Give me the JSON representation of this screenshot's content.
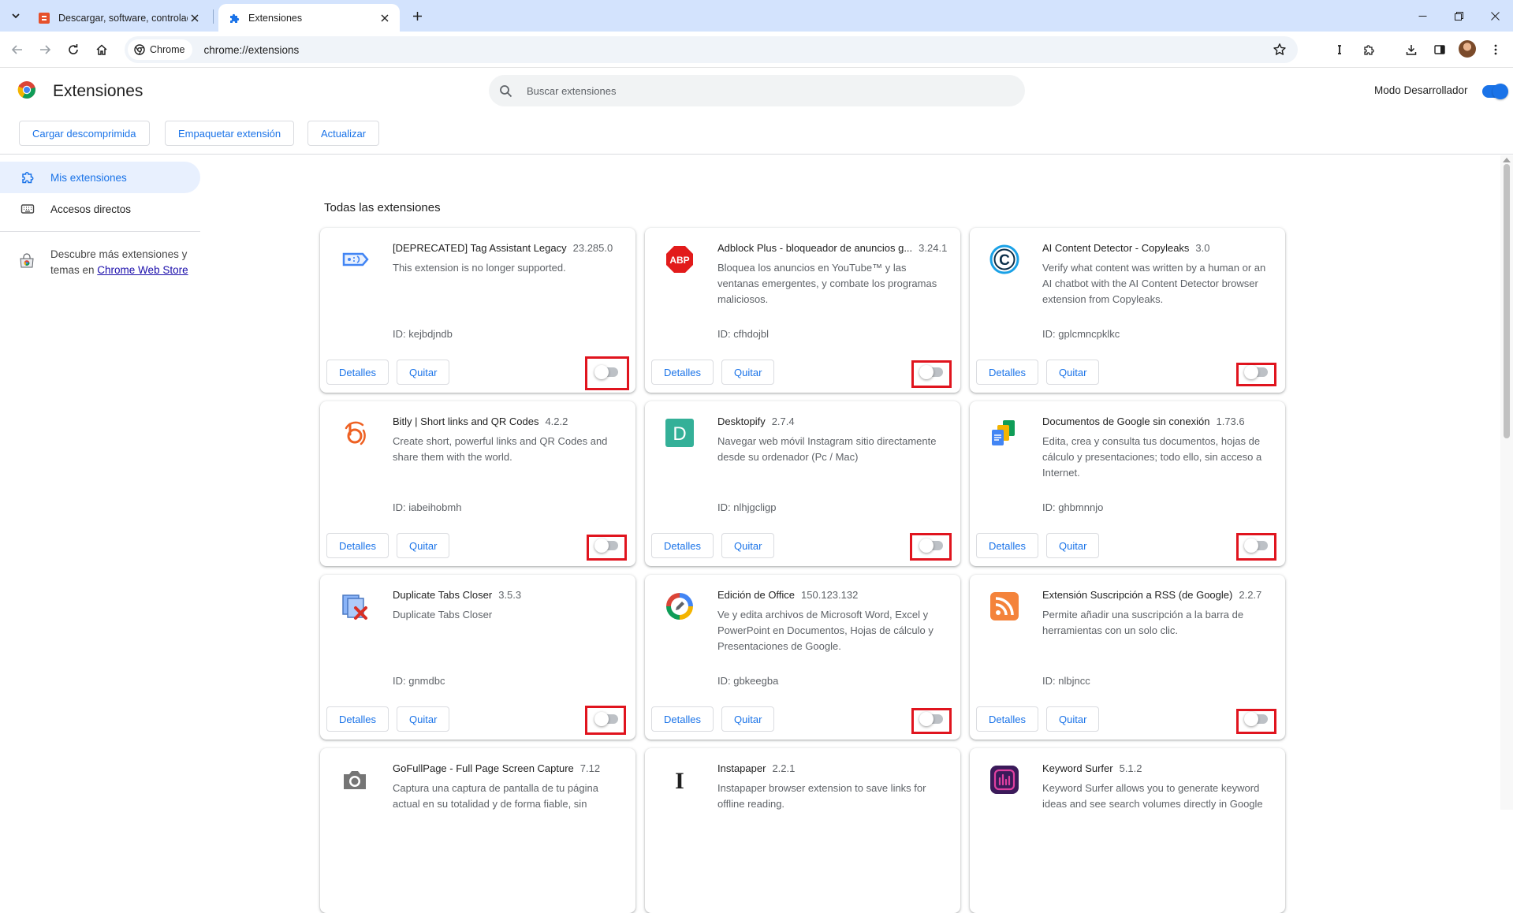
{
  "browser": {
    "tabs": [
      {
        "title": "Descargar, software, controladores, juegos, noticias, trucos",
        "icon": "softonic-favicon",
        "active": false
      },
      {
        "title": "Extensiones",
        "icon": "puzzle-icon",
        "active": true
      }
    ],
    "address": {
      "chip_label": "Chrome",
      "url": "chrome://extensions"
    },
    "toolbar_icons": [
      "back-icon",
      "forward-icon",
      "reload-icon",
      "home-icon",
      "bookmark-star-icon",
      "instapaper-icon",
      "extensions-puzzle-icon",
      "download-icon",
      "side-panel-icon",
      "profile-avatar",
      "menu-icon"
    ]
  },
  "header": {
    "title": "Extensiones",
    "search_placeholder": "Buscar extensiones",
    "dev_mode_label": "Modo Desarrollador",
    "dev_mode_on": true,
    "buttons": {
      "load_unpacked": "Cargar descomprimida",
      "pack": "Empaquetar extensión",
      "update": "Actualizar"
    }
  },
  "sidebar": {
    "items": [
      {
        "label": "Mis extensiones",
        "icon": "extension-icon",
        "selected": true
      },
      {
        "label": "Accesos directos",
        "icon": "keyboard-icon",
        "selected": false
      }
    ],
    "store_text": "Descubre más extensiones y temas en",
    "store_link": "Chrome Web Store"
  },
  "main": {
    "section_title": "Todas las extensiones",
    "details_label": "Detalles",
    "remove_label": "Quitar",
    "colors": {
      "accent": "#1a73e8",
      "highlight": "#e0141e",
      "toggle_off": "#bdc1c6"
    },
    "extensions": [
      {
        "name": "[DEPRECATED] Tag Assistant Legacy",
        "version": "23.285.0",
        "description": "This extension is no longer supported.",
        "id": "ID: kejbdjndb",
        "icon": "tag-assistant-icon",
        "enabled": false
      },
      {
        "name": "Adblock Plus - bloqueador de anuncios g...",
        "version": "3.24.1",
        "description": "Bloquea los anuncios en YouTube™ y las ventanas emergentes, y combate los programas maliciosos.",
        "id": "ID: cfhdojbl",
        "icon": "abp-icon",
        "enabled": false
      },
      {
        "name": "AI Content Detector - Copyleaks",
        "version": "3.0",
        "description": "Verify what content was written by a human or an AI chatbot with the AI Content Detector browser extension from Copyleaks.",
        "id": "ID: gplcmncpklkc",
        "icon": "copyleaks-icon",
        "enabled": false
      },
      {
        "name": "Bitly | Short links and QR Codes",
        "version": "4.2.2",
        "description": "Create short, powerful links and QR Codes and share them with the world.",
        "id": "ID: iabeihobmh",
        "icon": "bitly-icon",
        "enabled": false
      },
      {
        "name": "Desktopify",
        "version": "2.7.4",
        "description": "Navegar web móvil Instagram sitio directamente desde su ordenador (Pc / Mac)",
        "id": "ID: nlhjgcligp",
        "icon": "desktopify-icon",
        "enabled": false
      },
      {
        "name": "Documentos de Google sin conexión",
        "version": "1.73.6",
        "description": "Edita, crea y consulta tus documentos, hojas de cálculo y presentaciones; todo ello, sin acceso a Internet.",
        "id": "ID: ghbmnnjo",
        "icon": "google-docs-icon",
        "enabled": false
      },
      {
        "name": "Duplicate Tabs Closer",
        "version": "3.5.3",
        "description": "Duplicate Tabs Closer",
        "id": "ID: gnmdbc",
        "icon": "duplicate-tabs-icon",
        "enabled": false
      },
      {
        "name": "Edición de Office",
        "version": "150.123.132",
        "description": "Ve y edita archivos de Microsoft Word, Excel y PowerPoint en Documentos, Hojas de cálculo y Presentaciones de Google.",
        "id": "ID: gbkeegba",
        "icon": "office-editing-icon",
        "enabled": false
      },
      {
        "name": "Extensión Suscripción a RSS (de Google)",
        "version": "2.2.7",
        "description": "Permite añadir una suscripción a la barra de herramientas con un solo clic.",
        "id": "ID: nlbjncc",
        "icon": "rss-icon",
        "enabled": false
      },
      {
        "name": "GoFullPage - Full Page Screen Capture",
        "version": "7.12",
        "description": "Captura una captura de pantalla de tu página actual en su totalidad y de forma fiable, sin",
        "id": "",
        "icon": "camera-icon",
        "enabled": false
      },
      {
        "name": "Instapaper",
        "version": "2.2.1",
        "description": "Instapaper browser extension to save links for offline reading.",
        "id": "",
        "icon": "instapaper-icon",
        "enabled": false
      },
      {
        "name": "Keyword Surfer",
        "version": "5.1.2",
        "description": "Keyword Surfer allows you to generate keyword ideas and see search volumes directly in Google",
        "id": "",
        "icon": "keyword-surfer-icon",
        "enabled": false
      }
    ]
  }
}
